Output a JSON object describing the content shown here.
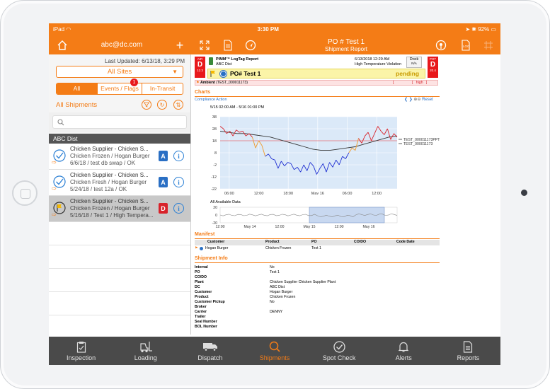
{
  "status": {
    "device": "iPad",
    "time": "3:30 PM",
    "battery": "92%"
  },
  "header": {
    "account": "abc@dc.com",
    "title": "PO # Test 1",
    "subtitle": "Shipment Report"
  },
  "left_panel": {
    "last_updated": "Last Updated: 6/13/18, 3:29 PM",
    "site_select": "All Sites",
    "filters": [
      {
        "label": "All"
      },
      {
        "label": "Events / Flags"
      },
      {
        "label": "In-Transit"
      }
    ],
    "filter_badge": "1",
    "list_title": "All Shipments",
    "group": "ABC Dist",
    "items": [
      {
        "title": "Chicken Supplier - Chicken S...",
        "line2": "Chicken Frozen / Hogan Burger",
        "line3": "6/6/18 / test db swap / OK",
        "badge": "A"
      },
      {
        "title": "Chicken Supplier - Chicken S...",
        "line2": "Chicken Fresh / Hogan Burger",
        "line3": "5/24/18 / test 12a / OK",
        "badge": "A"
      },
      {
        "title": "Chicken Supplier - Chicken S...",
        "line2": "Chicken Frozen / Hogan Burger",
        "line3": "5/16/18 / Test 1 / High Tempera...",
        "badge": "D"
      }
    ]
  },
  "report": {
    "left_box": {
      "top": "AIR",
      "grade": "D",
      "value": "12.3"
    },
    "right_box": {
      "top": "POT",
      "grade": "D",
      "value": "20.4"
    },
    "logger": "PIMM™ LogTag Report",
    "company": "ABC Dist",
    "date": "6/13/2018 12:29 AM",
    "violation": "High Temperature Violation",
    "dock_label": "Dock",
    "dock_value": "N/A",
    "po": "PO# Test 1",
    "state": "pending",
    "ambient": "Ambient",
    "ambient_id": "(TEST_000011173)",
    "ambient_flag": "high",
    "charts_heading": "Charts",
    "compliance": "Compliance Action",
    "reset": "Reset",
    "range": "5/15 02:00 AM - 5/16 01:00 PM",
    "all_data": "All Available Data",
    "manifest_heading": "Manifest",
    "manifest_cols": [
      "Customer",
      "Product",
      "PO",
      "CO/DO",
      "Code Date"
    ],
    "manifest_row": [
      "Hogan Burger",
      "Chicken Frozen",
      "Test 1",
      "",
      ""
    ],
    "shipment_heading": "Shipment Info",
    "shipment_info": [
      {
        "k": "Internal",
        "v": "No"
      },
      {
        "k": "PO",
        "v": "Test 1"
      },
      {
        "k": "CO/DO",
        "v": ""
      },
      {
        "k": "Plant",
        "v": "Chicken Supplier Chicken Supplier Plant"
      },
      {
        "k": "DC",
        "v": "ABC Dist"
      },
      {
        "k": "Customer",
        "v": "Hogan Burger"
      },
      {
        "k": "Product",
        "v": "Chicken Frozen"
      },
      {
        "k": "Customer Pickup",
        "v": "No"
      },
      {
        "k": "Broker",
        "v": ""
      },
      {
        "k": "Carrier",
        "v": "DENNY"
      },
      {
        "k": "Trailer",
        "v": ""
      },
      {
        "k": "Seal Number",
        "v": ""
      },
      {
        "k": "BOL Number",
        "v": ""
      }
    ]
  },
  "chart_data": {
    "type": "line",
    "y_ticks": [
      "38",
      "28",
      "18",
      "8",
      "-2",
      "-12",
      "-22"
    ],
    "x_ticks": [
      "06:00",
      "12:00",
      "18:00",
      "May 16",
      "06:00",
      "12:00"
    ],
    "series": [
      {
        "name": "TEST_000011173PPT",
        "values": [
          30,
          28,
          24,
          26,
          22,
          27,
          25,
          26,
          21,
          24,
          23,
          20,
          23,
          18,
          21,
          14,
          19,
          18,
          17
        ]
      },
      {
        "name": "TEST_000011173",
        "values": [
          26,
          25,
          24,
          24,
          23,
          22,
          21,
          19,
          17,
          15,
          13,
          11,
          10,
          10,
          11,
          12,
          13,
          15,
          17,
          19,
          21,
          22
        ]
      }
    ],
    "probe_series": [
      30,
      28,
      24,
      26,
      22,
      27,
      25,
      26,
      22,
      24,
      21,
      12,
      18,
      14,
      5,
      7,
      3,
      2,
      -5,
      1,
      -3,
      0,
      -1,
      -6,
      -4,
      -8,
      -2,
      -7,
      0,
      -3,
      -10,
      -5,
      -1,
      -8,
      0,
      -4,
      2,
      -2,
      5,
      3,
      8,
      12,
      10,
      20,
      16,
      22,
      25,
      18,
      24,
      30,
      26,
      23,
      28,
      19,
      24,
      21
    ],
    "y_range": [
      -22,
      38
    ],
    "navigator_ticks": [
      "12:00",
      "May 14",
      "12:00",
      "May 15",
      "12:00",
      "May 16"
    ],
    "navigator_y": [
      "20",
      "0",
      "-20"
    ],
    "reference_line": 18
  },
  "tabs": [
    {
      "label": "Inspection"
    },
    {
      "label": "Loading"
    },
    {
      "label": "Dispatch"
    },
    {
      "label": "Shipments"
    },
    {
      "label": "Spot Check"
    },
    {
      "label": "Alerts"
    },
    {
      "label": "Reports"
    }
  ],
  "colors": {
    "accent": "#f47c16",
    "grade": "#e8191c",
    "probe": "#1f2fd1",
    "high": "#d8222a",
    "band": "#dbe9f8"
  }
}
